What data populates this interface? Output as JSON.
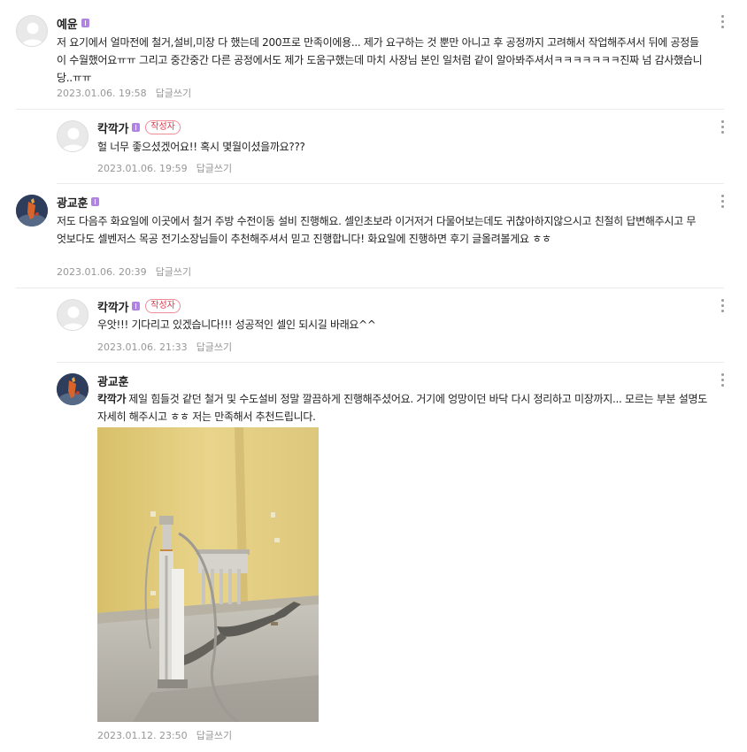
{
  "comments": [
    {
      "author": "예윤",
      "is_writer": false,
      "text": "저 요기에서 얼마전에 철거,설비,미장 다 했는데 200프로 만족이에용... 제가 요구하는 것 뿐만 아니고 후 공정까지 고려해서 작업해주셔서 뒤에 공정들이 수월했어요ㅠㅠ 그리고 중간중간 다른 공정에서도 제가 도움구했는데 마치 사장님 본인 일처럼 같이 알아봐주셔서ㅋㅋㅋㅋㅋㅋㅋ진짜 넘 감사했습니당..ㅠㅠ",
      "date": "2023.01.06. 19:58",
      "reply_label": "답글쓰기"
    },
    {
      "author": "칵깍가",
      "is_writer": true,
      "writer_badge": "작성자",
      "text": "헐 너무 좋으셨겠어요!! 혹시 몇월이셨을까요???",
      "date": "2023.01.06. 19:59",
      "reply_label": "답글쓰기"
    },
    {
      "author": "광교훈",
      "is_writer": false,
      "text": "저도 다음주 화요일에 이곳에서 철거 주방 수전이동 설비 진행해요. 셀인초보라 이거저거 다물어보는데도 귀찮아하지않으시고 친절히 답변해주시고 무엇보다도 셀벤저스 목공 전기소장님들이 추천해주셔서 믿고 진행합니다! 화요일에 진행하면 후기 글올려볼게요 ㅎㅎ",
      "date": "2023.01.06. 20:39",
      "reply_label": "답글쓰기"
    },
    {
      "author": "칵깍가",
      "is_writer": true,
      "writer_badge": "작성자",
      "text": "우앗!!! 기다리고 있겠습니다!!! 성공적인 셀인 되시길 바래요^^",
      "date": "2023.01.06. 21:33",
      "reply_label": "답글쓰기"
    },
    {
      "author": "광교훈",
      "is_writer": false,
      "mention": "칵깍가",
      "text": "제일 힘들것 같던 철거 및 수도설비 정말 깔끔하게 진행해주셨어요. 거기에 엉망이던 바닥 다시 정리하고 미장까지... 모르는 부분 설명도 자세히 해주시고 ㅎㅎ 저는 만족해서 추천드립니다.",
      "date": "2023.01.12. 23:50",
      "reply_label": "답글쓰기"
    }
  ],
  "icons": {
    "default_avatar": "person-silhouette-icon",
    "level_badge": "level-1-icon",
    "more_menu": "more-vertical-icon"
  },
  "colors": {
    "level_badge": "#b084e0",
    "writer_badge": "#e0364a",
    "meta_text": "#979797",
    "divider": "#ebebeb"
  }
}
